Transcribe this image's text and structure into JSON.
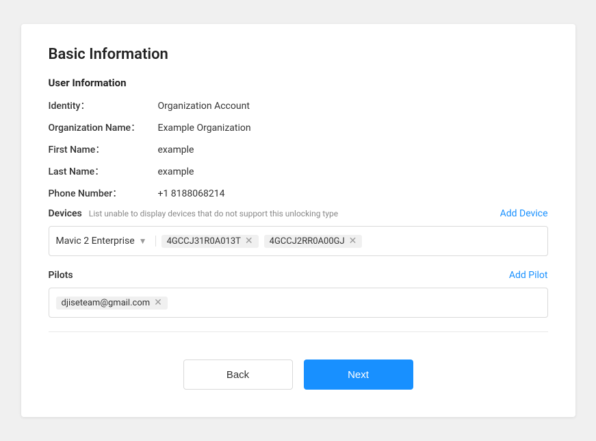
{
  "card": {
    "section_title": "Basic Information",
    "subsection_title": "User Information",
    "fields": [
      {
        "label": "Identity：",
        "value": "Organization Account"
      },
      {
        "label": "Organization Name：",
        "value": "Example Organization"
      },
      {
        "label": "First Name：",
        "value": "example"
      },
      {
        "label": "Last Name：",
        "value": "example"
      },
      {
        "label": "Phone Number：",
        "value": "+1 8188068214"
      }
    ],
    "devices": {
      "label": "Devices",
      "hint": "List unable to display devices that do not support this unlocking type",
      "add_link": "Add Device",
      "select_value": "Mavic 2 Enterprise",
      "tags": [
        {
          "id": "tag-1",
          "value": "4GCCJ31R0A013T"
        },
        {
          "id": "tag-2",
          "value": "4GCCJ2RR0A00GJ"
        }
      ]
    },
    "pilots": {
      "label": "Pilots",
      "add_link": "Add Pilot",
      "tags": [
        {
          "id": "pilot-1",
          "value": "djiseteam@gmail.com"
        }
      ]
    },
    "buttons": {
      "back": "Back",
      "next": "Next"
    }
  }
}
